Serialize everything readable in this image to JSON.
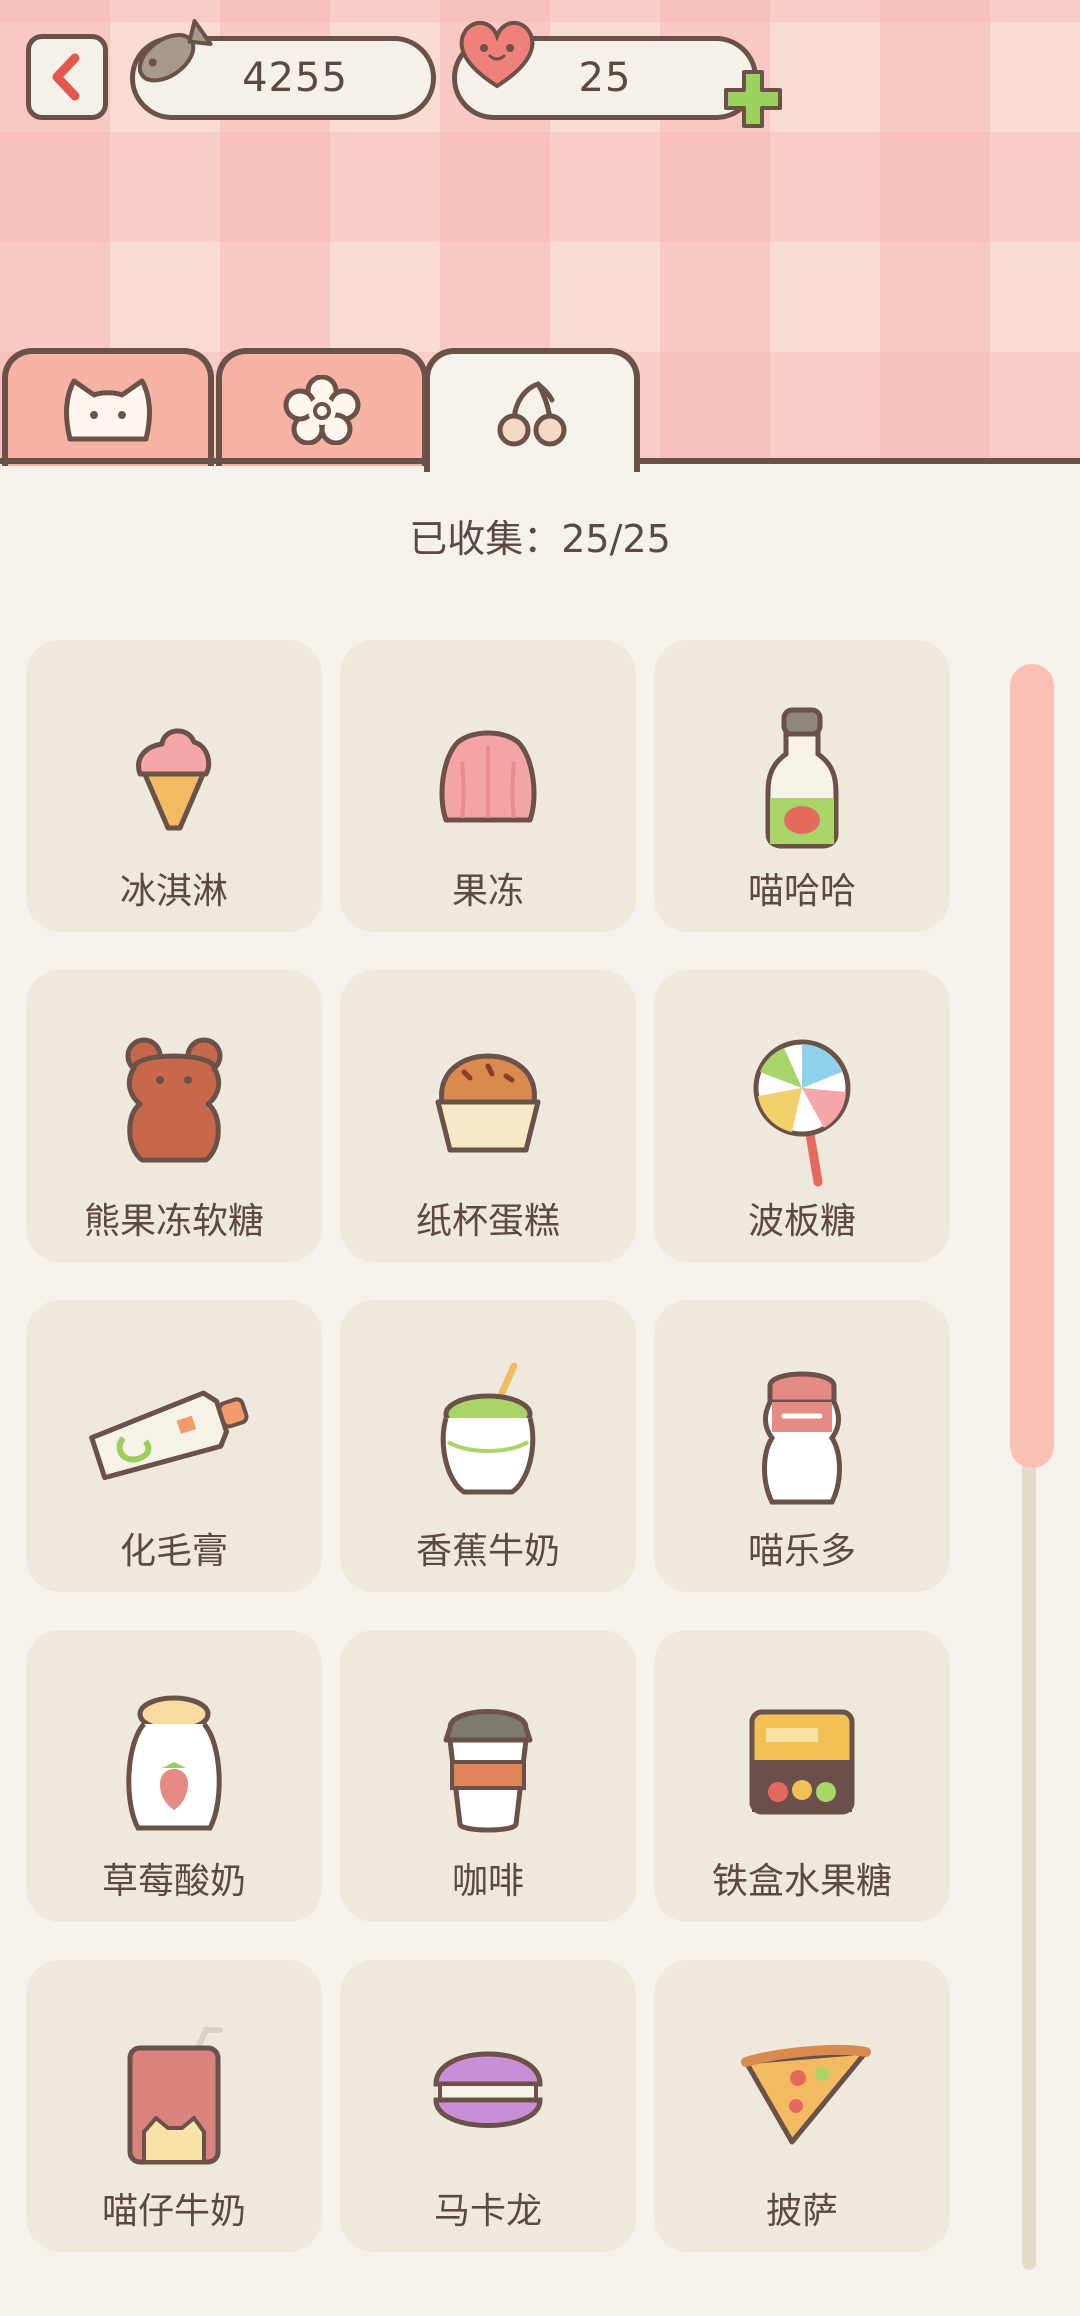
{
  "header": {
    "fish_count": "4255",
    "heart_count": "25"
  },
  "tabs": [
    {
      "icon": "cat-face-icon"
    },
    {
      "icon": "flower-icon"
    },
    {
      "icon": "cherry-icon",
      "selected": true
    }
  ],
  "collected_text": "已收集：25/25",
  "items": [
    {
      "name": "冰淇淋",
      "icon": "ice-cream-icon"
    },
    {
      "name": "果冻",
      "icon": "jelly-icon"
    },
    {
      "name": "喵哈哈",
      "icon": "bottle-icon"
    },
    {
      "name": "熊果冻软糖",
      "icon": "gummy-bear-icon"
    },
    {
      "name": "纸杯蛋糕",
      "icon": "cupcake-icon"
    },
    {
      "name": "波板糖",
      "icon": "lollipop-icon"
    },
    {
      "name": "化毛膏",
      "icon": "paste-tube-icon"
    },
    {
      "name": "香蕉牛奶",
      "icon": "banana-milk-icon"
    },
    {
      "name": "喵乐多",
      "icon": "yakult-bottle-icon"
    },
    {
      "name": "草莓酸奶",
      "icon": "strawberry-yogurt-icon"
    },
    {
      "name": "咖啡",
      "icon": "coffee-cup-icon"
    },
    {
      "name": "铁盒水果糖",
      "icon": "candy-tin-icon"
    },
    {
      "name": "喵仔牛奶",
      "icon": "milk-carton-icon"
    },
    {
      "name": "马卡龙",
      "icon": "macaron-icon"
    },
    {
      "name": "披萨",
      "icon": "pizza-icon"
    }
  ],
  "colors": {
    "accent": "#f6b3a5",
    "outline": "#6a5249",
    "card": "#efe8dc",
    "background": "#f5f2ec"
  }
}
